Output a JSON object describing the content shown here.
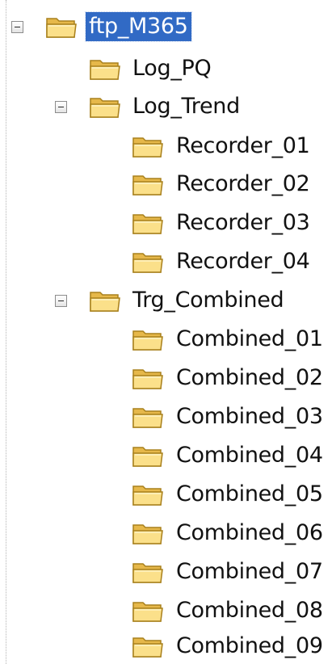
{
  "tree": {
    "root": {
      "label": "ftp_M365",
      "selected": true,
      "icon": "folder-icon"
    },
    "log_pq": {
      "label": "Log_PQ",
      "icon": "folder-icon"
    },
    "log_trend": {
      "label": "Log_Trend",
      "icon": "folder-icon",
      "children": [
        {
          "label": "Recorder_01"
        },
        {
          "label": "Recorder_02"
        },
        {
          "label": "Recorder_03"
        },
        {
          "label": "Recorder_04"
        }
      ]
    },
    "trg_combined": {
      "label": "Trg_Combined",
      "icon": "folder-icon",
      "children": [
        {
          "label": "Combined_01"
        },
        {
          "label": "Combined_02"
        },
        {
          "label": "Combined_03"
        },
        {
          "label": "Combined_04"
        },
        {
          "label": "Combined_05"
        },
        {
          "label": "Combined_06"
        },
        {
          "label": "Combined_07"
        },
        {
          "label": "Combined_08"
        },
        {
          "label": "Combined_09"
        }
      ]
    }
  },
  "colors": {
    "selection": "#316ac5",
    "folder": "#f5d36b",
    "folder_outline": "#b88a1c"
  }
}
